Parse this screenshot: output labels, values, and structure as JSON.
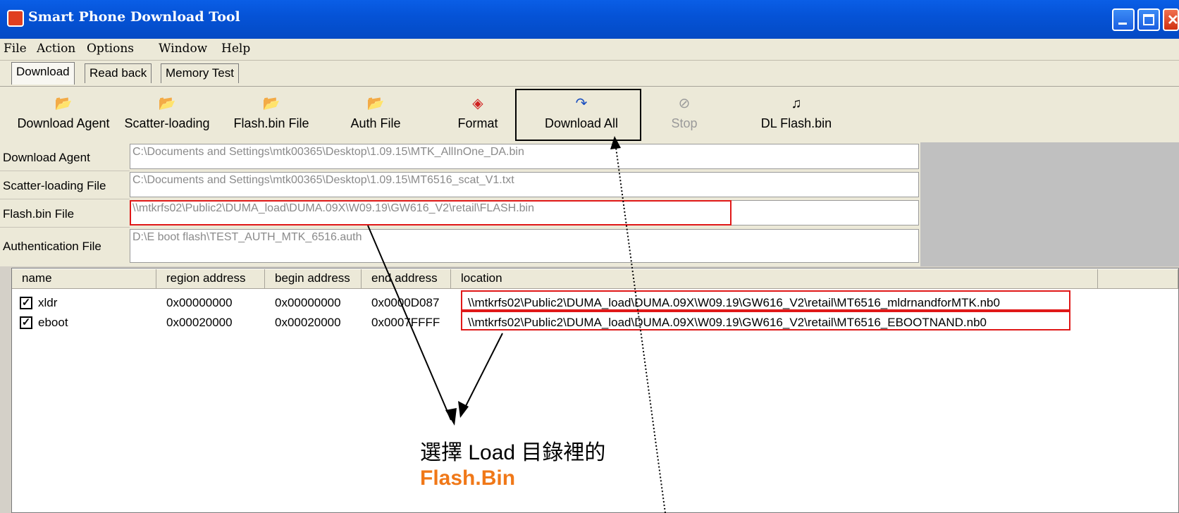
{
  "window": {
    "title": "Smart Phone Download Tool"
  },
  "menu": [
    "File",
    "Action",
    "Options",
    "Window",
    "Help"
  ],
  "tabs": [
    "Download",
    "Read back",
    "Memory Test"
  ],
  "toolbar": {
    "download_agent": "Download Agent",
    "scatter_loading": "Scatter-loading",
    "flash_bin_file": "Flash.bin File",
    "auth_file": "Auth File",
    "format": "Format",
    "download_all": "Download All",
    "stop": "Stop",
    "dl_flash_bin": "DL Flash.bin"
  },
  "fields": {
    "download_agent": {
      "label": "Download Agent",
      "value": "C:\\Documents and Settings\\mtk00365\\Desktop\\1.09.15\\MTK_AllInOne_DA.bin"
    },
    "scatter_loading": {
      "label": "Scatter-loading File",
      "value": "C:\\Documents and Settings\\mtk00365\\Desktop\\1.09.15\\MT6516_scat_V1.txt"
    },
    "flash_bin": {
      "label": "Flash.bin File",
      "value": "\\\\mtkrfs02\\Public2\\DUMA_load\\DUMA.09X\\W09.19\\GW616_V2\\retail\\FLASH.bin"
    },
    "authentication": {
      "label": "Authentication File",
      "value": "D:\\E boot flash\\TEST_AUTH_MTK_6516.auth"
    }
  },
  "table": {
    "columns": [
      "name",
      "region address",
      "begin address",
      "end address",
      "location"
    ],
    "rows": [
      {
        "checked": true,
        "name": "xldr",
        "region": "0x00000000",
        "begin": "0x00000000",
        "end": "0x0000D087",
        "location": "\\\\mtkrfs02\\Public2\\DUMA_load\\DUMA.09X\\W09.19\\GW616_V2\\retail\\MT6516_mldrnandforMTK.nb0"
      },
      {
        "checked": true,
        "name": "eboot",
        "region": "0x00020000",
        "begin": "0x00020000",
        "end": "0x0007FFFF",
        "location": "\\\\mtkrfs02\\Public2\\DUMA_load\\DUMA.09X\\W09.19\\GW616_V2\\retail\\MT6516_EBOOTNAND.nb0"
      }
    ]
  },
  "annotation": {
    "line1": "選擇 Load 目錄裡的",
    "line2": "Flash.Bin"
  },
  "colors": {
    "highlight_red": "#e01818",
    "annotation_orange": "#f07818",
    "titlebar_blue": "#0553d7"
  }
}
